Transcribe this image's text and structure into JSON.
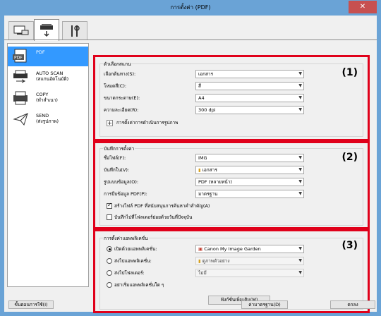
{
  "window": {
    "title": "การตั้งค่า (PDF)",
    "close_label": "✕"
  },
  "tabs": [
    {
      "name": "scan-from-computer",
      "icon": "computer-scan-icon"
    },
    {
      "name": "scan-from-panel",
      "icon": "scanner-icon"
    },
    {
      "name": "general-settings",
      "icon": "tools-icon"
    }
  ],
  "sidebar": {
    "items": [
      {
        "label": "PDF",
        "icon": "pdf-icon"
      },
      {
        "label": "AUTO SCAN",
        "sublabel": "(สแกนอัตโนมัติ)",
        "icon": "auto-scan-icon"
      },
      {
        "label": "COPY",
        "sublabel": "(ทำสำเนา)",
        "icon": "copy-icon"
      },
      {
        "label": "SEND",
        "sublabel": "(ส่งรูปภาพ)",
        "icon": "send-icon"
      }
    ]
  },
  "section1": {
    "title": "ตัวเลือกสแกน",
    "number": "(1)",
    "fields": [
      {
        "label": "เลือกต้นทาง(S):",
        "value": "เอกสาร"
      },
      {
        "label": "โหมดสี(C):",
        "value": "สี"
      },
      {
        "label": "ขนาดกระดาษ(E):",
        "value": "A4"
      },
      {
        "label": "ความละเอียด(R):",
        "value": "300 dpi"
      }
    ],
    "expand_label": "การตั้งค่าการดำเนินการรูปภาพ"
  },
  "section2": {
    "title": "บันทึกการตั้งค่า",
    "number": "(2)",
    "fields": [
      {
        "label": "ชื่อไฟล์(F):",
        "value": "IMG"
      },
      {
        "label": "บันทึกใน(V):",
        "value": "เอกสาร"
      },
      {
        "label": "รูปแบบข้อมูล(O):",
        "value": "PDF (หลายหน้า)"
      },
      {
        "label": "การบีบข้อมูล PDF(P):",
        "value": "มาตรฐาน"
      }
    ],
    "check1": "สร้างไฟล์ PDF ที่สนับสนุนการค้นหาคำสำคัญ(A)",
    "check2": "บันทึกไปที่โฟลเดอร์ย่อยด้วยวันที่ปัจจุบัน"
  },
  "section3": {
    "title": "การตั้งค่าแอพพลิเคชั่น",
    "number": "(3)",
    "options": [
      {
        "label": "เปิดด้วยแอพพลิเคชั่น:",
        "value": "Canon My Image Garden"
      },
      {
        "label": "ส่งไปแอพพลิเคชั่น:",
        "value": "ดูภาพตัวอย่าง"
      },
      {
        "label": "ส่งไปโฟลเดอร์:",
        "value": "ไม่มี"
      },
      {
        "label": "อย่าเริ่มแอพพลิเคชั่นใด ๆ"
      }
    ],
    "more_functions": "ฟังก์ชั่นเพิ่มเติม(M)"
  },
  "footer": {
    "instructions": "ขั้นตอนการใช้(I)",
    "defaults": "ค่ามาตรฐาน(D)",
    "ok": "ตกลง"
  }
}
